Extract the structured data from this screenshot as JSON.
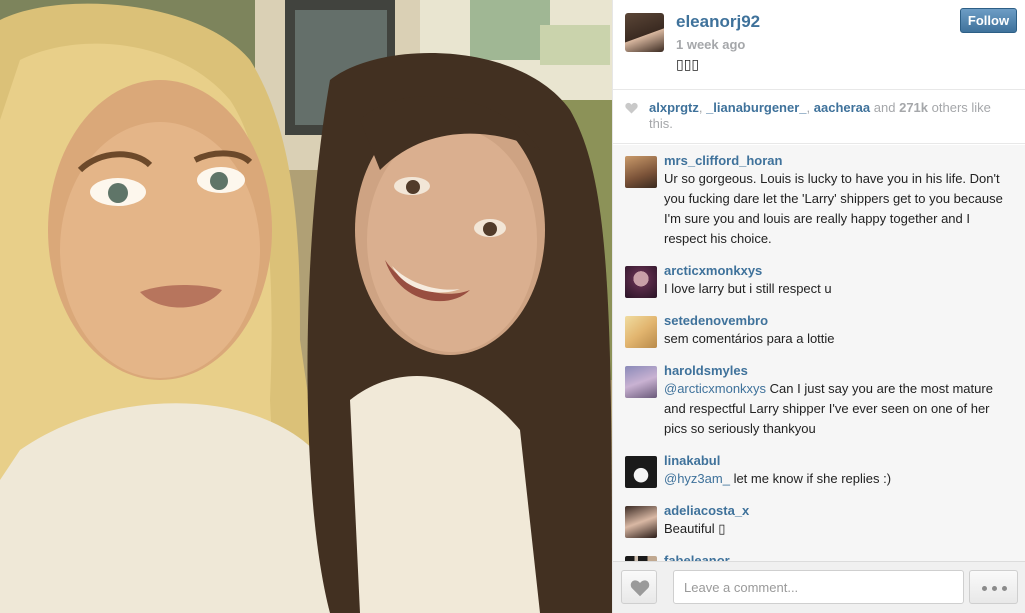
{
  "post": {
    "username": "eleanorj92",
    "time": "1 week ago",
    "caption": "▯▯▯",
    "follow_label": "Follow"
  },
  "likes": {
    "users": [
      "alxprgtz",
      "_lianaburgener_",
      "aacheraa"
    ],
    "and_text": "and",
    "count": "271k",
    "suffix": "others like this."
  },
  "comments": [
    {
      "user": "mrs_clifford_horan",
      "text": "Ur so gorgeous. Louis is lucky to have you in his life. Don't you fucking dare let the 'Larry' shippers get to you because I'm sure you and louis are really happy together and I respect his choice.",
      "mention": ""
    },
    {
      "user": "arcticxmonkxys",
      "text": "I love larry but i still respect u",
      "mention": ""
    },
    {
      "user": "setedenovembro",
      "text": "sem comentários para a lottie",
      "mention": ""
    },
    {
      "user": "haroldsmyles",
      "mention": "@arcticxmonkxys",
      "text": " Can I just say you are the most mature and respectful Larry shipper I've ever seen on one of her pics so seriously thankyou"
    },
    {
      "user": "linakabul",
      "mention": "@hyz3am_",
      "text": " let me know if she replies :)"
    },
    {
      "user": "adeliacosta_x",
      "text": "Beautiful ▯",
      "mention": ""
    },
    {
      "user": "fabeleanor",
      "text": "",
      "mention": ""
    }
  ],
  "composer": {
    "placeholder": "Leave a comment..."
  },
  "colors": {
    "link": "#3f729b",
    "muted": "#a5a7aa",
    "comments_bg": "#f6f6f6"
  },
  "icons": [
    "heart-icon",
    "more-dots-icon"
  ]
}
